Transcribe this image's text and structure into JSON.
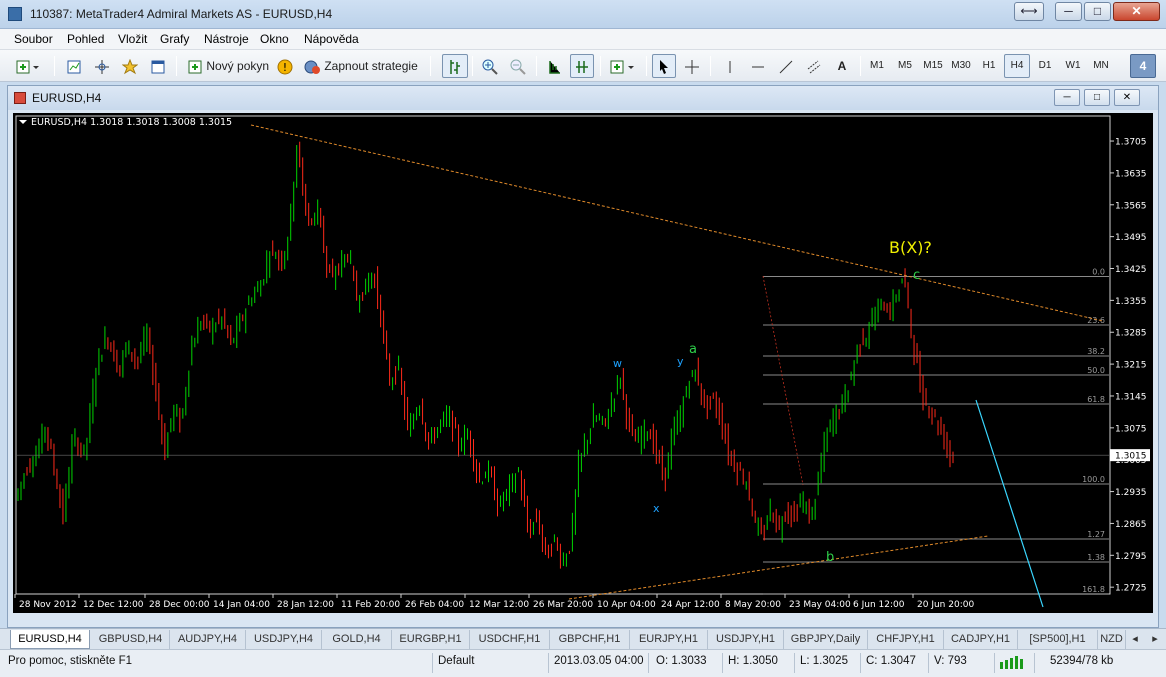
{
  "window": {
    "title": "110387: MetaTrader4 Admiral Markets AS - EURUSD,H4",
    "buttons": {
      "switch": "⟷",
      "minimize": "─",
      "maximize": "□",
      "close": "✕"
    }
  },
  "menu": [
    "Soubor",
    "Pohled",
    "Vložit",
    "Grafy",
    "Nástroje",
    "Okno",
    "Nápověda"
  ],
  "toolbar": {
    "new_order": "Nový pokyn",
    "strategy": "Zapnout strategie",
    "text_tool": "A",
    "timeframes": [
      "M1",
      "M5",
      "M15",
      "M30",
      "H1",
      "H4",
      "D1",
      "W1",
      "MN"
    ],
    "active_timeframe": "H4",
    "badge": "4"
  },
  "chart_window": {
    "title": "EURUSD,H4",
    "buttons": {
      "minimize": "─",
      "maximize": "□",
      "close": "✕"
    }
  },
  "chart_data": {
    "type": "line",
    "symbol_header": "EURUSD,H4  1.3018 1.3018 1.3008 1.3015",
    "current_price": "1.3015",
    "y_ticks": [
      "1.3705",
      "1.3635",
      "1.3565",
      "1.3495",
      "1.3425",
      "1.3355",
      "1.3285",
      "1.3215",
      "1.3145",
      "1.3075",
      "1.3005",
      "1.2935",
      "1.2865",
      "1.2795",
      "1.2725"
    ],
    "y_range": [
      1.271,
      1.376
    ],
    "x_ticks": [
      "28 Nov 2012",
      "12 Dec 12:00",
      "28 Dec 00:00",
      "14 Jan 04:00",
      "28 Jan 12:00",
      "11 Feb 20:00",
      "26 Feb 04:00",
      "12 Mar 12:00",
      "26 Mar 20:00",
      "10 Apr 04:00",
      "24 Apr 12:00",
      "8 May 20:00",
      "23 May 04:00",
      "6 Jun 12:00",
      "20 Jun 20:00"
    ],
    "fib_levels": [
      "0.0",
      "23.6",
      "38.2",
      "50.0",
      "61.8",
      "100.0",
      "1.27",
      "1.38",
      "161.8"
    ],
    "annotations": [
      "B(X)?",
      "c",
      "a",
      "y",
      "w",
      "x",
      "b"
    ],
    "price_path": [
      [
        0,
        1.292
      ],
      [
        12,
        1.299
      ],
      [
        22,
        1.302
      ],
      [
        30,
        1.308
      ],
      [
        38,
        1.3
      ],
      [
        48,
        1.288
      ],
      [
        58,
        1.305
      ],
      [
        70,
        1.302
      ],
      [
        82,
        1.322
      ],
      [
        92,
        1.328
      ],
      [
        104,
        1.32
      ],
      [
        112,
        1.326
      ],
      [
        122,
        1.322
      ],
      [
        132,
        1.328
      ],
      [
        142,
        1.314
      ],
      [
        150,
        1.302
      ],
      [
        158,
        1.312
      ],
      [
        166,
        1.308
      ],
      [
        176,
        1.325
      ],
      [
        186,
        1.331
      ],
      [
        196,
        1.329
      ],
      [
        206,
        1.332
      ],
      [
        216,
        1.326
      ],
      [
        226,
        1.331
      ],
      [
        236,
        1.336
      ],
      [
        246,
        1.339
      ],
      [
        256,
        1.347
      ],
      [
        266,
        1.344
      ],
      [
        274,
        1.35
      ],
      [
        282,
        1.37
      ],
      [
        290,
        1.356
      ],
      [
        298,
        1.352
      ],
      [
        304,
        1.357
      ],
      [
        312,
        1.342
      ],
      [
        318,
        1.34
      ],
      [
        326,
        1.344
      ],
      [
        334,
        1.346
      ],
      [
        342,
        1.336
      ],
      [
        350,
        1.338
      ],
      [
        358,
        1.342
      ],
      [
        366,
        1.332
      ],
      [
        374,
        1.318
      ],
      [
        384,
        1.32
      ],
      [
        394,
        1.306
      ],
      [
        404,
        1.314
      ],
      [
        414,
        1.304
      ],
      [
        424,
        1.308
      ],
      [
        434,
        1.31
      ],
      [
        444,
        1.304
      ],
      [
        454,
        1.306
      ],
      [
        464,
        1.296
      ],
      [
        474,
        1.298
      ],
      [
        484,
        1.29
      ],
      [
        494,
        1.294
      ],
      [
        504,
        1.298
      ],
      [
        514,
        1.284
      ],
      [
        522,
        1.288
      ],
      [
        532,
        1.279
      ],
      [
        540,
        1.283
      ],
      [
        548,
        1.278
      ],
      [
        556,
        1.282
      ],
      [
        564,
        1.299
      ],
      [
        572,
        1.305
      ],
      [
        580,
        1.31
      ],
      [
        590,
        1.308
      ],
      [
        598,
        1.314
      ],
      [
        606,
        1.319
      ],
      [
        614,
        1.308
      ],
      [
        622,
        1.304
      ],
      [
        632,
        1.308
      ],
      [
        642,
        1.302
      ],
      [
        650,
        1.296
      ],
      [
        658,
        1.306
      ],
      [
        666,
        1.31
      ],
      [
        674,
        1.318
      ],
      [
        682,
        1.32
      ],
      [
        690,
        1.312
      ],
      [
        698,
        1.314
      ],
      [
        706,
        1.31
      ],
      [
        714,
        1.302
      ],
      [
        724,
        1.298
      ],
      [
        732,
        1.296
      ],
      [
        740,
        1.287
      ],
      [
        748,
        1.283
      ],
      [
        756,
        1.29
      ],
      [
        764,
        1.285
      ],
      [
        772,
        1.29
      ],
      [
        780,
        1.288
      ],
      [
        788,
        1.292
      ],
      [
        796,
        1.287
      ],
      [
        804,
        1.296
      ],
      [
        812,
        1.306
      ],
      [
        820,
        1.31
      ],
      [
        828,
        1.313
      ],
      [
        836,
        1.318
      ],
      [
        844,
        1.326
      ],
      [
        852,
        1.328
      ],
      [
        860,
        1.332
      ],
      [
        868,
        1.335
      ],
      [
        876,
        1.333
      ],
      [
        884,
        1.338
      ],
      [
        890,
        1.341
      ],
      [
        896,
        1.33
      ],
      [
        902,
        1.322
      ],
      [
        908,
        1.314
      ],
      [
        916,
        1.312
      ],
      [
        924,
        1.308
      ],
      [
        932,
        1.304
      ],
      [
        936,
        1.3015
      ]
    ]
  },
  "tabs": [
    "EURUSD,H4",
    "GBPUSD,H4",
    "AUDJPY,H4",
    "USDJPY,H4",
    "GOLD,H4",
    "EURGBP,H1",
    "USDCHF,H1",
    "GBPCHF,H1",
    "EURJPY,H1",
    "USDJPY,H1",
    "GBPJPY,Daily",
    "CHFJPY,H1",
    "CADJPY,H1",
    "[SP500],H1",
    "NZD"
  ],
  "status": {
    "help": "Pro pomoc, stiskněte F1",
    "profile": "Default",
    "datetime": "2013.03.05 04:00",
    "open": "O: 1.3033",
    "high": "H: 1.3050",
    "low": "L: 1.3025",
    "close": "C: 1.3047",
    "volume": "V: 793",
    "traffic": "52394/78 kb"
  },
  "colors": {
    "bull": "#00d400",
    "bear": "#ff2a1a",
    "trend": "#e08a2a",
    "fib": "#b8b8b8",
    "cyan": "#3ad7ff",
    "yellow": "#f0f000",
    "green_label": "#2ed04a",
    "blue_label": "#1ea2ff"
  }
}
